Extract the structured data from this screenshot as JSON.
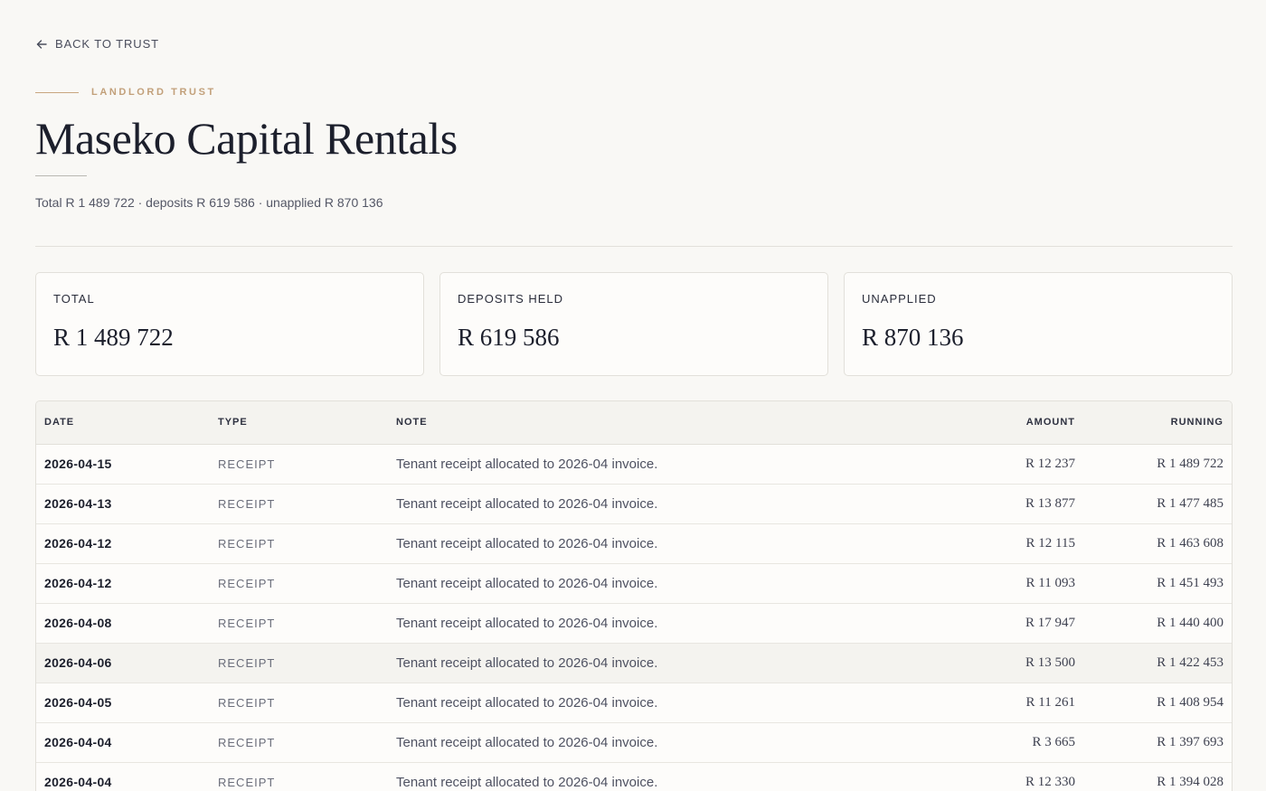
{
  "nav": {
    "back_label": "BACK TO TRUST",
    "back_icon": "arrow-left-icon"
  },
  "header": {
    "eyebrow": "LANDLORD TRUST",
    "title": "Maseko Capital Rentals",
    "summary": "Total R 1 489 722 · deposits R 619 586 · unapplied R 870 136"
  },
  "cards": [
    {
      "label": "TOTAL",
      "value": "R 1 489 722"
    },
    {
      "label": "DEPOSITS HELD",
      "value": "R 619 586"
    },
    {
      "label": "UNAPPLIED",
      "value": "R 870 136"
    }
  ],
  "table": {
    "columns": {
      "date": "DATE",
      "type": "TYPE",
      "note": "NOTE",
      "amount": "AMOUNT",
      "running": "RUNNING"
    },
    "rows": [
      {
        "date": "2026-04-15",
        "type": "RECEIPT",
        "note": "Tenant receipt allocated to 2026-04 invoice.",
        "amount": "R 12 237",
        "running": "R 1 489 722"
      },
      {
        "date": "2026-04-13",
        "type": "RECEIPT",
        "note": "Tenant receipt allocated to 2026-04 invoice.",
        "amount": "R 13 877",
        "running": "R 1 477 485"
      },
      {
        "date": "2026-04-12",
        "type": "RECEIPT",
        "note": "Tenant receipt allocated to 2026-04 invoice.",
        "amount": "R 12 115",
        "running": "R 1 463 608"
      },
      {
        "date": "2026-04-12",
        "type": "RECEIPT",
        "note": "Tenant receipt allocated to 2026-04 invoice.",
        "amount": "R 11 093",
        "running": "R 1 451 493"
      },
      {
        "date": "2026-04-08",
        "type": "RECEIPT",
        "note": "Tenant receipt allocated to 2026-04 invoice.",
        "amount": "R 17 947",
        "running": "R 1 440 400"
      },
      {
        "date": "2026-04-06",
        "type": "RECEIPT",
        "note": "Tenant receipt allocated to 2026-04 invoice.",
        "amount": "R 13 500",
        "running": "R 1 422 453"
      },
      {
        "date": "2026-04-05",
        "type": "RECEIPT",
        "note": "Tenant receipt allocated to 2026-04 invoice.",
        "amount": "R 11 261",
        "running": "R 1 408 954"
      },
      {
        "date": "2026-04-04",
        "type": "RECEIPT",
        "note": "Tenant receipt allocated to 2026-04 invoice.",
        "amount": "R 3 665",
        "running": "R 1 397 693"
      },
      {
        "date": "2026-04-04",
        "type": "RECEIPT",
        "note": "Tenant receipt allocated to 2026-04 invoice.",
        "amount": "R 12 330",
        "running": "R 1 394 028"
      }
    ]
  }
}
